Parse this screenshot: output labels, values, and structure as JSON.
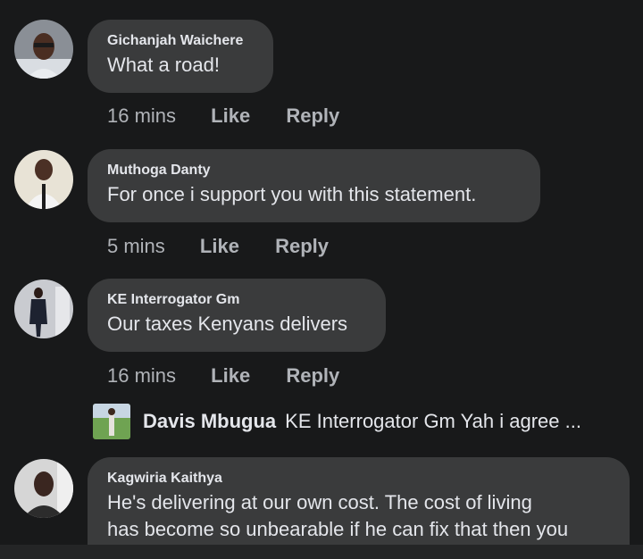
{
  "comments": [
    {
      "author": "Gichanjah Waichere",
      "text": "What a road!",
      "time": "16 mins",
      "like": "Like",
      "reply": "Reply"
    },
    {
      "author": "Muthoga Danty",
      "text": "For once i support you with this statement.",
      "time": "5 mins",
      "like": "Like",
      "reply": "Reply"
    },
    {
      "author": "KE Interrogator Gm",
      "text": "Our taxes Kenyans delivers",
      "time": "16 mins",
      "like": "Like",
      "reply": "Reply"
    },
    {
      "author": "Kagwiria Kaithya",
      "text_line1": "He's delivering at our own cost. The cost of living",
      "text_line2": "has become so unbearable if he can fix that then you"
    }
  ],
  "reply_preview": {
    "author": "Davis Mbugua",
    "text": "KE Interrogator Gm Yah i agree ..."
  },
  "colors": {
    "background": "#18191a",
    "bubble": "#3a3b3c",
    "primary_text": "#e4e6eb",
    "secondary_text": "#b0b3b8"
  }
}
